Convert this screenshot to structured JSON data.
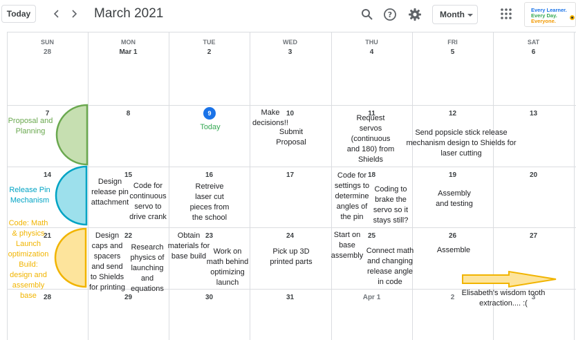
{
  "toolbar": {
    "today_label": "Today",
    "prev_icon": "chevron-left-icon",
    "next_icon": "chevron-right-icon",
    "month_title": "March 2021",
    "search_icon": "search-icon",
    "help_icon": "help-icon",
    "settings_icon": "gear-icon",
    "view_select": "Month",
    "apps_icon": "apps-grid-icon",
    "logo_lines": [
      "Every Learner.",
      "Every Day.",
      "Everyone."
    ]
  },
  "weekdays": [
    "SUN",
    "MON",
    "TUE",
    "WED",
    "THU",
    "FRI",
    "SAT"
  ],
  "weeks": [
    [
      "28",
      "Mar 1",
      "2",
      "3",
      "4",
      "5",
      "6"
    ],
    [
      "7",
      "8",
      "9",
      "10",
      "11",
      "12",
      "13"
    ],
    [
      "14",
      "15",
      "16",
      "17",
      "18",
      "19",
      "20"
    ],
    [
      "21",
      "22",
      "23",
      "24",
      "25",
      "26",
      "27"
    ],
    [
      "28",
      "29",
      "30",
      "31",
      "Apr 1",
      "2",
      "3"
    ]
  ],
  "today_text": "Today",
  "phases": [
    {
      "label": "Proposal and\nPlanning",
      "color": "#6aa84f",
      "fill": "#c6dfb1"
    },
    {
      "label": "Release Pin\nMechanism",
      "color": "#00a3c4",
      "fill": "#9de0ec"
    },
    {
      "label": "Code: Math\n& physics\nLaunch\noptimization\nBuild:\ndesign and\nassembly\nbase",
      "color": "#f1b400",
      "fill": "#fde49c"
    }
  ],
  "notes": {
    "make_decisions": "Make\ndecisions!!",
    "submit_proposal": "Submit\nProposal",
    "request_servos": "Request\nservos\n(continuous\nand 180) from\nShields",
    "send_popsicle": "Send popsicle stick release\nmechanism design to Shields for\nlaser cutting",
    "design_release_pin": "Design\nrelease pin\nattachment",
    "code_continuous": "Code for\ncontinuous\nservo to\ndrive crank",
    "retreive": "Retreive\nlaser cut\npieces from\nthe school",
    "code_settings": "Code for\nsettings to\ndetermine\nangles of\nthe pin",
    "coding_brake": "Coding to\nbrake the\nservo so it\nstays still?",
    "assembly_testing": "Assembly\nand testing",
    "design_caps": "Design\ncaps and\nspacers\nand send\nto Shields\nfor printing",
    "research_physics": "Research\nphysics of\nlaunching\nand\nequations",
    "obtain_materials": "Obtain\nmaterials for\nbase build",
    "work_on_math": "Work on\nmath behind\noptimizing\nlaunch",
    "pick_up_3d": "Pick up 3D\nprinted parts",
    "start_on_base": "Start on\nbase\nassembly",
    "connect_math": "Connect math\nand changing\nrelease angle\nin code",
    "assemble": "Assemble",
    "wisdom_tooth": "Elisabeth's wisdom tooth\nextraction.... :("
  },
  "colors": {
    "accent_blue": "#1a73e8",
    "today_green": "#34a853",
    "arrow_fill": "#fde49c",
    "arrow_stroke": "#f1b400"
  }
}
